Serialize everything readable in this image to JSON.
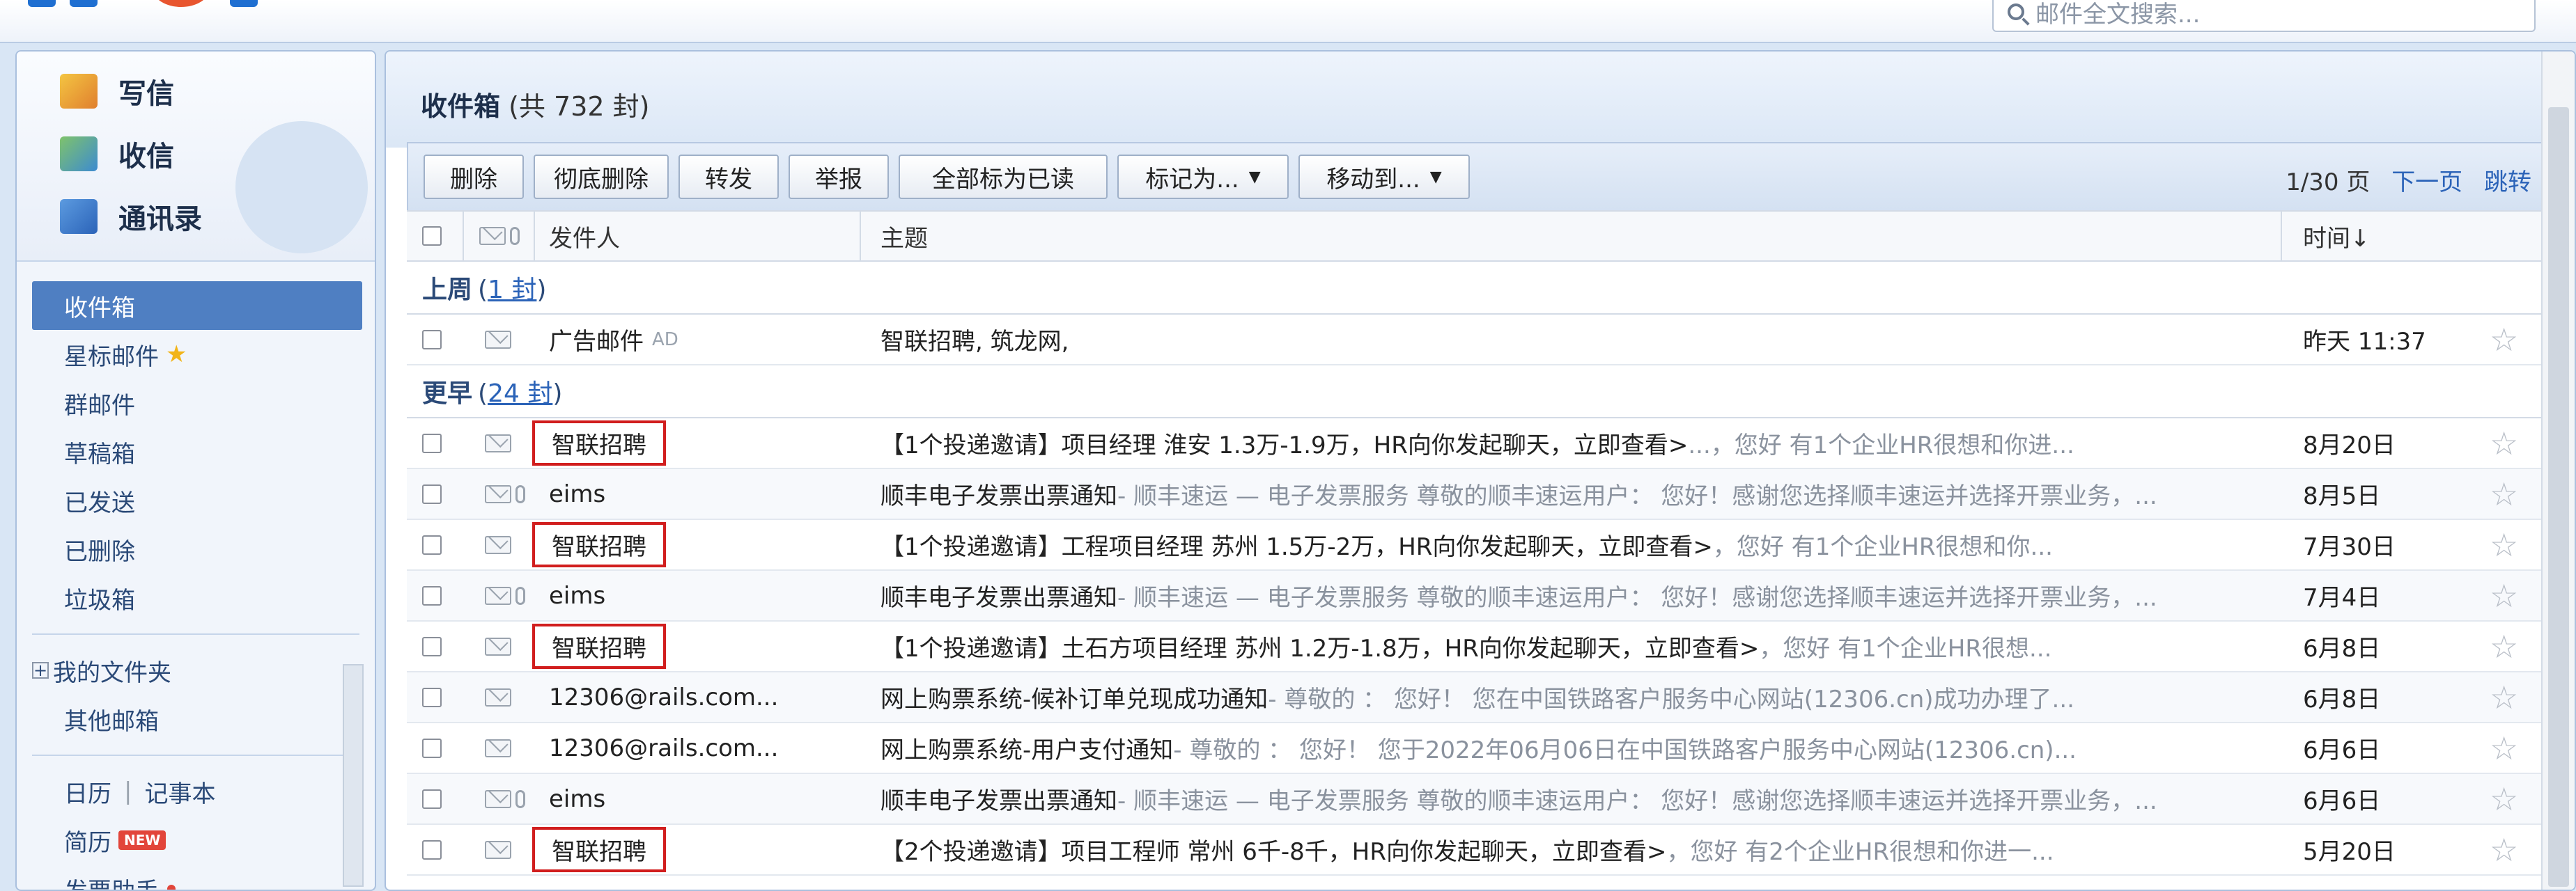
{
  "search": {
    "placeholder": "邮件全文搜索..."
  },
  "quick": [
    {
      "label": "写信",
      "icon": "compose-icon"
    },
    {
      "label": "收信",
      "icon": "receive-icon"
    },
    {
      "label": "通讯录",
      "icon": "contacts-icon"
    }
  ],
  "folders": {
    "inbox": "收件箱",
    "starred": "星标邮件",
    "group": "群邮件",
    "drafts": "草稿箱",
    "sent": "已发送",
    "deleted": "已删除",
    "spam": "垃圾箱",
    "my_folders": "我的文件夹",
    "other": "其他邮箱",
    "calendar": "日历",
    "notepad": "记事本",
    "divider": "|",
    "resume": "简历",
    "new_badge": "NEW",
    "invoice": "发票助手"
  },
  "main": {
    "title": "收件箱",
    "count": "(共 732 封)",
    "pager": {
      "page": "1/30 页",
      "next": "下一页",
      "jump": "跳转"
    }
  },
  "toolbar": {
    "delete": "删除",
    "perm_delete": "彻底删除",
    "forward": "转发",
    "report": "举报",
    "mark_all_read": "全部标为已读",
    "mark_as": "标记为...",
    "move_to": "移动到..."
  },
  "columns": {
    "sender": "发件人",
    "subject": "主题",
    "time": "时间↓"
  },
  "groups": {
    "last_week": {
      "label": "上周",
      "count": "(1 封)",
      "count_num": "1 封"
    },
    "earlier": {
      "label": "更早",
      "count": "(24 封)",
      "count_num": "24 封"
    }
  },
  "last_week_rows": [
    {
      "sender": "广告邮件",
      "ad": "AD",
      "subject": "智联招聘, 筑龙网,",
      "preview": "",
      "time": "昨天 11:37"
    }
  ],
  "earlier_rows": [
    {
      "sender": "智联招聘",
      "subject": "【1个投递邀请】项目经理 淮安 1.3万-1.9万，HR向你发起聊天，立即查看>",
      "preview": "...，您好    有1个企业HR很想和你进...",
      "time": "8月20日",
      "attach": false,
      "boxed": true
    },
    {
      "sender": "eims",
      "subject": "顺丰电子发票出票通知",
      "preview": " - 顺丰速运 — 电子发票服务  尊敬的顺丰速运用户： 您好！感谢您选择顺丰速运并选择开票业务，...",
      "time": "8月5日",
      "attach": true,
      "boxed": false
    },
    {
      "sender": "智联招聘",
      "subject": "【1个投递邀请】工程项目经理 苏州 1.5万-2万，HR向你发起聊天，立即查看>",
      "preview": "，您好    有1个企业HR很想和你...",
      "time": "7月30日",
      "attach": false,
      "boxed": true
    },
    {
      "sender": "eims",
      "subject": "顺丰电子发票出票通知",
      "preview": " - 顺丰速运 — 电子发票服务  尊敬的顺丰速运用户： 您好！感谢您选择顺丰速运并选择开票业务，...",
      "time": "7月4日",
      "attach": true,
      "boxed": false
    },
    {
      "sender": "智联招聘",
      "subject": "【1个投递邀请】土石方项目经理 苏州 1.2万-1.8万，HR向你发起聊天，立即查看>",
      "preview": "，您好    有1个企业HR很想...",
      "time": "6月8日",
      "attach": false,
      "boxed": true
    },
    {
      "sender": "12306@rails.com...",
      "subject": "网上购票系统-候补订单兑现成功通知",
      "preview": " - 尊敬的  ：  您好！ 您在中国铁路客户服务中心网站(12306.cn)成功办理了...",
      "time": "6月8日",
      "attach": false,
      "boxed": false
    },
    {
      "sender": "12306@rails.com...",
      "subject": "网上购票系统-用户支付通知",
      "preview": " - 尊敬的  ：  您好！ 您于2022年06月06日在中国铁路客户服务中心网站(12306.cn)...",
      "time": "6月6日",
      "attach": false,
      "boxed": false
    },
    {
      "sender": "eims",
      "subject": "顺丰电子发票出票通知",
      "preview": " - 顺丰速运 — 电子发票服务  尊敬的顺丰速运用户： 您好！感谢您选择顺丰速运并选择开票业务，...",
      "time": "6月6日",
      "attach": true,
      "boxed": false
    },
    {
      "sender": "智联招聘",
      "subject": "【2个投递邀请】项目工程师 常州 6千-8千，HR向你发起聊天，立即查看>",
      "preview": "，您好    有2个企业HR很想和你进一...",
      "time": "5月20日",
      "attach": false,
      "boxed": true
    }
  ],
  "colors": {
    "accent": "#4f7fc2",
    "highlight_box": "#d11e1e",
    "link": "#2b63b8"
  }
}
